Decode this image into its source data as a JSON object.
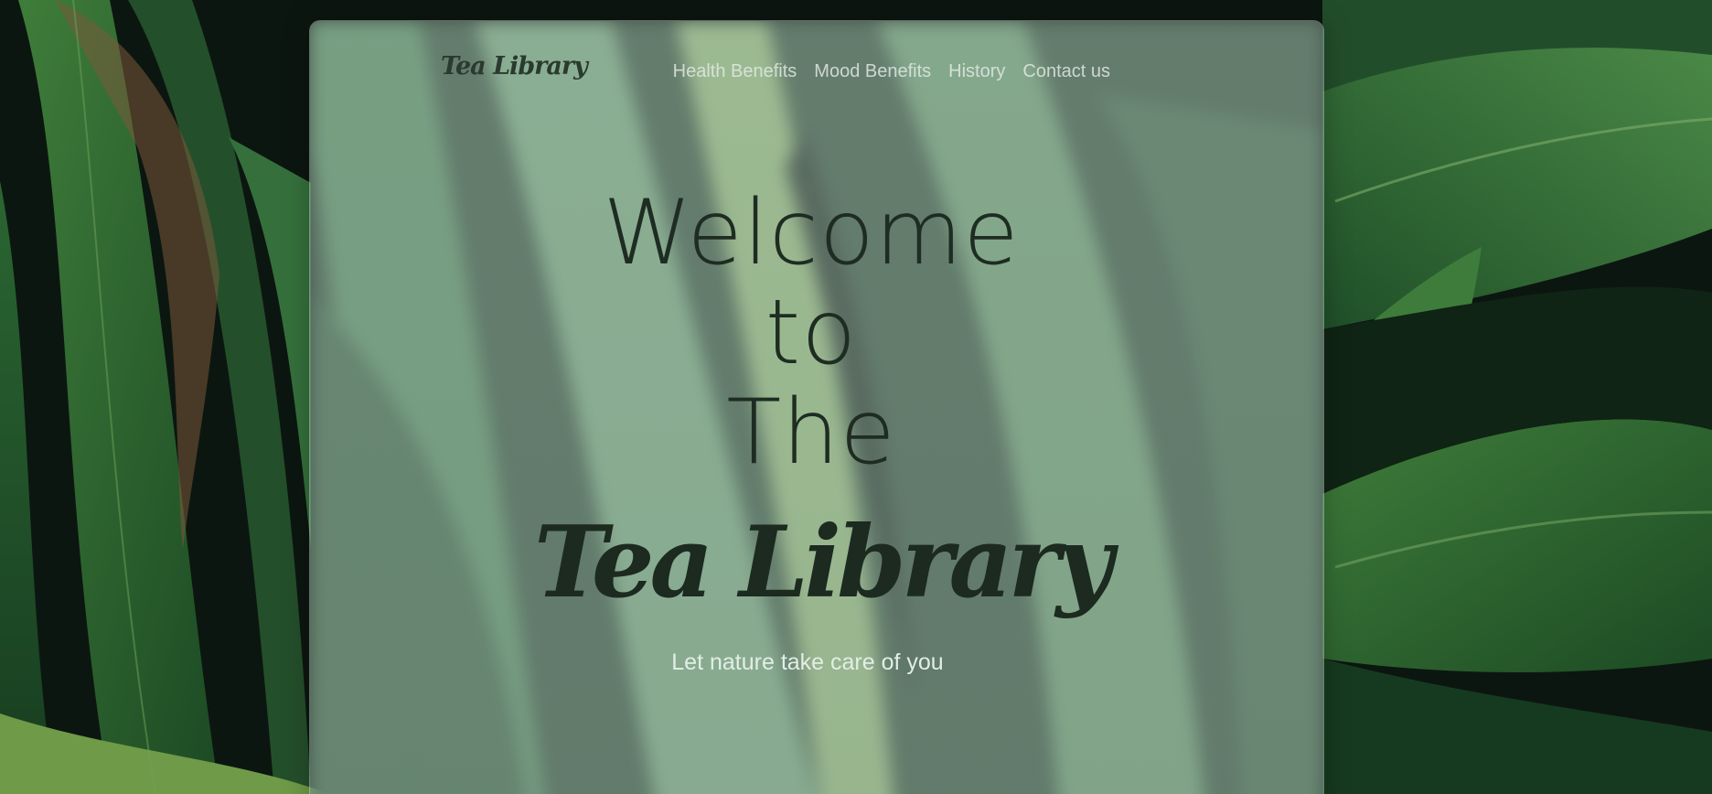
{
  "nav": {
    "brand": "Tea Library",
    "links": [
      {
        "label": "Health Benefits"
      },
      {
        "label": "Mood Benefits"
      },
      {
        "label": "History"
      },
      {
        "label": "Contact us"
      }
    ]
  },
  "hero": {
    "line1": "Welcome",
    "line2": "to",
    "line3": "The",
    "brand": "Tea Library",
    "tagline": "Let nature take care of you"
  },
  "colors": {
    "leaf_dark": "#1f4a2a",
    "leaf_mid": "#2f6b38",
    "leaf_light": "#5c8f4a",
    "heading": "#1e2c22",
    "tagline": "#e3ede6"
  }
}
